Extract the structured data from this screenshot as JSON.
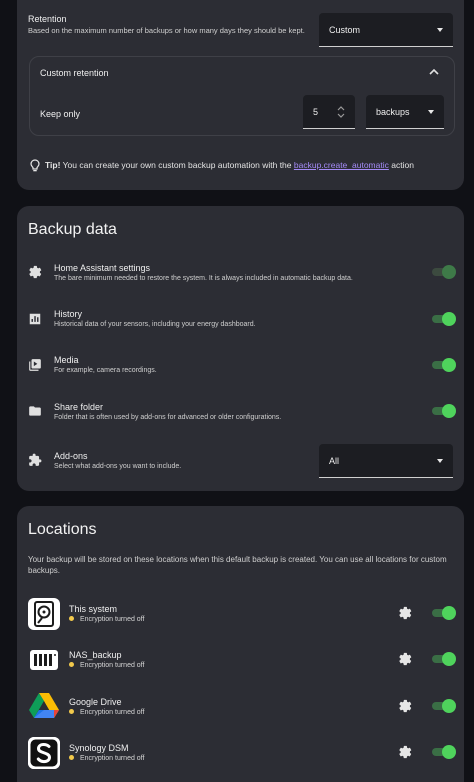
{
  "retention": {
    "title": "Retention",
    "description": "Based on the maximum number of backups or how many days they should be kept.",
    "select_value": "Custom",
    "custom": {
      "title": "Custom retention",
      "keep_label": "Keep only",
      "keep_value": "5",
      "unit_value": "backups"
    },
    "tip": {
      "label": "Tip!",
      "text": "You can create your own custom backup automation with the",
      "link": "backup.create_automatic",
      "suffix": "action"
    }
  },
  "backup_data": {
    "title": "Backup data",
    "items": [
      {
        "title": "Home Assistant settings",
        "subtitle": "The bare minimum needed to restore the system. It is always included in automatic backup data.",
        "icon": "gear-icon",
        "enabled": true,
        "locked": true
      },
      {
        "title": "History",
        "subtitle": "Historical data of your sensors, including your energy dashboard.",
        "icon": "chart-icon",
        "enabled": true,
        "locked": false
      },
      {
        "title": "Media",
        "subtitle": "For example, camera recordings.",
        "icon": "media-icon",
        "enabled": true,
        "locked": false
      },
      {
        "title": "Share folder",
        "subtitle": "Folder that is often used by add-ons for advanced or older configurations.",
        "icon": "folder-icon",
        "enabled": true,
        "locked": false
      }
    ],
    "addons": {
      "title": "Add-ons",
      "subtitle": "Select what add-ons you want to include.",
      "icon": "puzzle-icon",
      "select_value": "All"
    }
  },
  "locations": {
    "title": "Locations",
    "description": "Your backup will be stored on these locations when this default backup is created. You can use all locations for custom backups.",
    "items": [
      {
        "title": "This system",
        "status": "Encryption turned off",
        "icon": "harddisk-icon",
        "enabled": true
      },
      {
        "title": "NAS_backup",
        "status": "Encryption turned off",
        "icon": "nas-icon",
        "enabled": true
      },
      {
        "title": "Google Drive",
        "status": "Encryption turned off",
        "icon": "google-drive-icon",
        "enabled": true
      },
      {
        "title": "Synology DSM",
        "status": "Encryption turned off",
        "icon": "synology-icon",
        "enabled": true
      }
    ]
  },
  "colors": {
    "background": "#101116",
    "card": "#2c2d34",
    "toggle_on": "#4fd35c",
    "status_dot": "#f2c94c",
    "link": "#a48bf7"
  }
}
